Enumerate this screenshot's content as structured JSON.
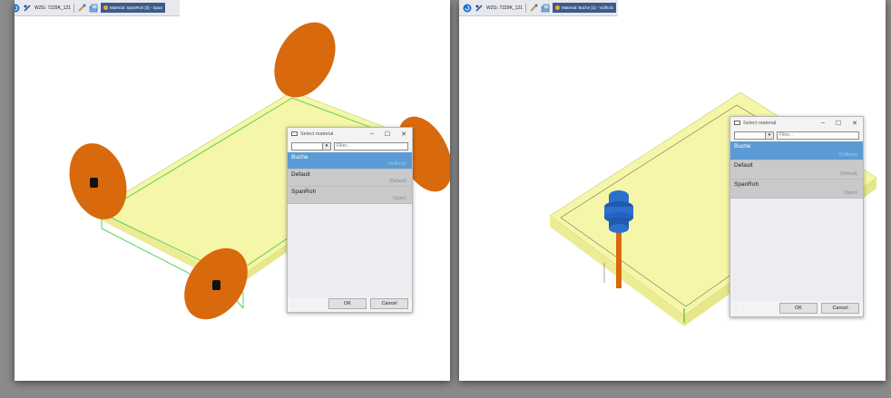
{
  "left": {
    "toolbar": {
      "wzg_label": "WZG: 7229K_121",
      "material_tab": "Material: SpanRoh [3] - Span"
    },
    "dialog": {
      "title": "Select material",
      "filter_placeholder": "Filter...",
      "items": [
        {
          "name": "Buche",
          "sub": "(Vollholz)",
          "selected": true
        },
        {
          "name": "Default",
          "sub": "(Default)",
          "selected": false
        },
        {
          "name": "SpanRoh",
          "sub": "(Span)",
          "selected": false
        }
      ],
      "ok_label": "OK",
      "cancel_label": "Cancel"
    }
  },
  "right": {
    "toolbar": {
      "wzg_label": "WZG: 7229K_121",
      "material_tab": "Material: Buche [1] - Vollholz"
    },
    "dialog": {
      "title": "Select material",
      "filter_placeholder": "Filter...",
      "items": [
        {
          "name": "Buche",
          "sub": "(Vollholz)",
          "selected": true
        },
        {
          "name": "Default",
          "sub": "(Default)",
          "selected": false
        },
        {
          "name": "SpanRoh",
          "sub": "(Span)",
          "selected": false
        }
      ],
      "ok_label": "OK",
      "cancel_label": "Cancel"
    }
  },
  "colors": {
    "board": "#f6f6a8",
    "disc": "#d8690c",
    "tool_blue": "#2c6fcc",
    "selection_blue": "#5b9bd5"
  }
}
